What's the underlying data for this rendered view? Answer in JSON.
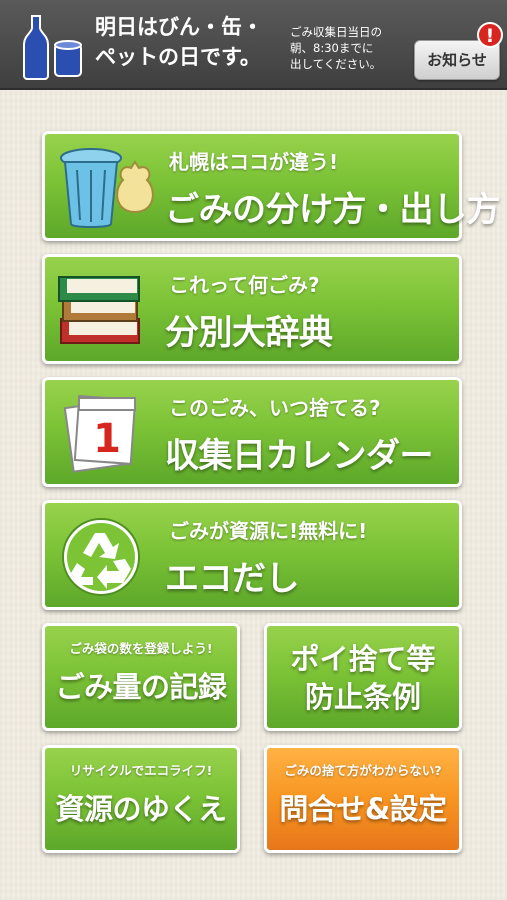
{
  "header": {
    "title": "明日はびん・缶・\nペットの日です。",
    "note": "ごみ収集日当日の\n朝、8:30までに\n出してください。",
    "notice_button": "お知らせ",
    "notice_badge": "!"
  },
  "menu": [
    {
      "subtitle": "札幌はココが違う!",
      "title": "ごみの分け方・出し方",
      "icon": "trash-can-icon"
    },
    {
      "subtitle": "これって何ごみ?",
      "title": "分別大辞典",
      "icon": "books-icon"
    },
    {
      "subtitle": "このごみ、いつ捨てる?",
      "title": "収集日カレンダー",
      "icon": "calendar-icon",
      "calendar_number": "1"
    },
    {
      "subtitle": "ごみが資源に!無料に!",
      "title": "エコだし",
      "icon": "recycle-icon"
    }
  ],
  "tiles": [
    {
      "subtitle": "ごみ袋の数を登録しよう!",
      "title": "ごみ量の記録"
    },
    {
      "title": "ポイ捨て等\n防止条例"
    },
    {
      "subtitle": "リサイクルでエコライフ!",
      "title": "資源のゆくえ"
    },
    {
      "subtitle": "ごみの捨て方がわからない?",
      "title": "問合せ&設定"
    }
  ],
  "colors": {
    "header": "#4a4a4a",
    "button_green": "#7cc336",
    "button_orange": "#f79521",
    "badge_red": "#d7261f"
  }
}
